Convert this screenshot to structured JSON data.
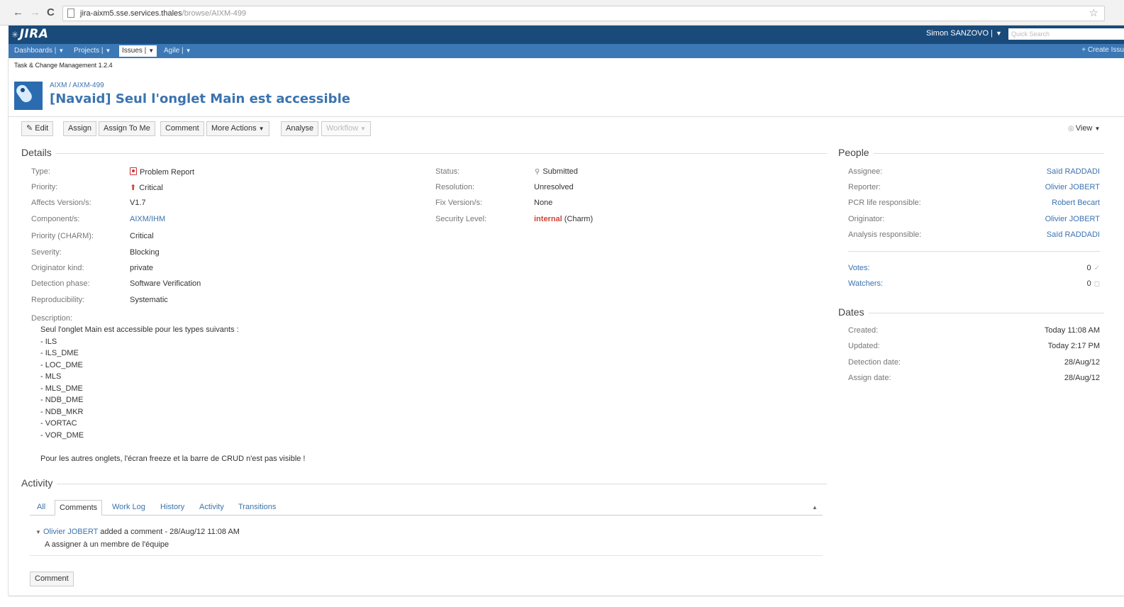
{
  "browser": {
    "url_host": "jira-aixm5.sse.services.thales",
    "url_path": "/browse/AIXM-499",
    "back_label": "←",
    "forward_label": "→",
    "reload_label": "C",
    "star_label": "☆"
  },
  "header": {
    "logo": "JIRA",
    "logo_star": "✳",
    "user": "Simon SANZOVO",
    "quick_search_placeholder": "Quick Search"
  },
  "nav": {
    "items": [
      {
        "label": "Dashboards"
      },
      {
        "label": "Projects"
      },
      {
        "label": "Issues"
      },
      {
        "label": "Agile"
      }
    ],
    "create_issue": "+ Create Issu"
  },
  "project": {
    "name": "Task & Change Management 1.2.4"
  },
  "issue": {
    "breadcrumb": "AIXM / AIXM-499",
    "title": "[Navaid] Seul l'onglet Main est accessible"
  },
  "toolbar": {
    "edit": "Edit",
    "assign": "Assign",
    "assign_to_me": "Assign To Me",
    "comment": "Comment",
    "more_actions": "More Actions",
    "analyse": "Analyse",
    "workflow": "Workflow",
    "view": "View"
  },
  "details": {
    "heading": "Details",
    "left": [
      {
        "label": "Type:",
        "value": "Problem Report"
      },
      {
        "label": "Priority:",
        "value": "Critical"
      },
      {
        "label": "Affects Version/s:",
        "value": "V1.7"
      },
      {
        "label": "Component/s:",
        "value": "AIXM/IHM"
      },
      {
        "label": "Priority (CHARM):",
        "value": "Critical"
      },
      {
        "label": "Severity:",
        "value": "Blocking"
      },
      {
        "label": "Originator kind:",
        "value": "private"
      },
      {
        "label": "Detection phase:",
        "value": "Software Verification"
      },
      {
        "label": "Reproducibility:",
        "value": "Systematic"
      }
    ],
    "right": [
      {
        "label": "Status:",
        "value": "Submitted"
      },
      {
        "label": "Resolution:",
        "value": "Unresolved"
      },
      {
        "label": "Fix Version/s:",
        "value": "None"
      },
      {
        "label": "Security Level:",
        "value_strong": "internal",
        "value_rest": " (Charm)"
      }
    ]
  },
  "description": {
    "label": "Description:",
    "lines": [
      "Seul l'onglet Main est accessible pour les types suivants :",
      "- ILS",
      "- ILS_DME",
      "- LOC_DME",
      "- MLS",
      "- MLS_DME",
      "- NDB_DME",
      "- NDB_MKR",
      "- VORTAC",
      "- VOR_DME",
      "Pour les autres onglets, l'écran freeze et la barre de CRUD n'est pas visible !"
    ]
  },
  "people": {
    "heading": "People",
    "rows": [
      {
        "label": "Assignee:",
        "value": "Saïd RADDADI"
      },
      {
        "label": "Reporter:",
        "value": "Olivier JOBERT"
      },
      {
        "label": "PCR life responsible:",
        "value": "Robert Becart"
      },
      {
        "label": "Originator:",
        "value": "Olivier JOBERT"
      },
      {
        "label": "Analysis responsible:",
        "value": "Saïd RADDADI"
      }
    ],
    "votes_label": "Votes:",
    "votes_value": "0",
    "watchers_label": "Watchers:",
    "watchers_value": "0"
  },
  "dates": {
    "heading": "Dates",
    "rows": [
      {
        "label": "Created:",
        "value": "Today 11:08 AM"
      },
      {
        "label": "Updated:",
        "value": "Today 2:17 PM"
      },
      {
        "label": "Detection date:",
        "value": "28/Aug/12"
      },
      {
        "label": "Assign date:",
        "value": "28/Aug/12"
      }
    ]
  },
  "activity": {
    "heading": "Activity",
    "tabs": [
      "All",
      "Comments",
      "Work Log",
      "History",
      "Activity",
      "Transitions"
    ],
    "comment_author": "Olivier JOBERT",
    "comment_meta": " added a comment - 28/Aug/12 11:08 AM",
    "comment_body": "A assigner à un membre de l'équipe",
    "comment_button": "Comment"
  }
}
